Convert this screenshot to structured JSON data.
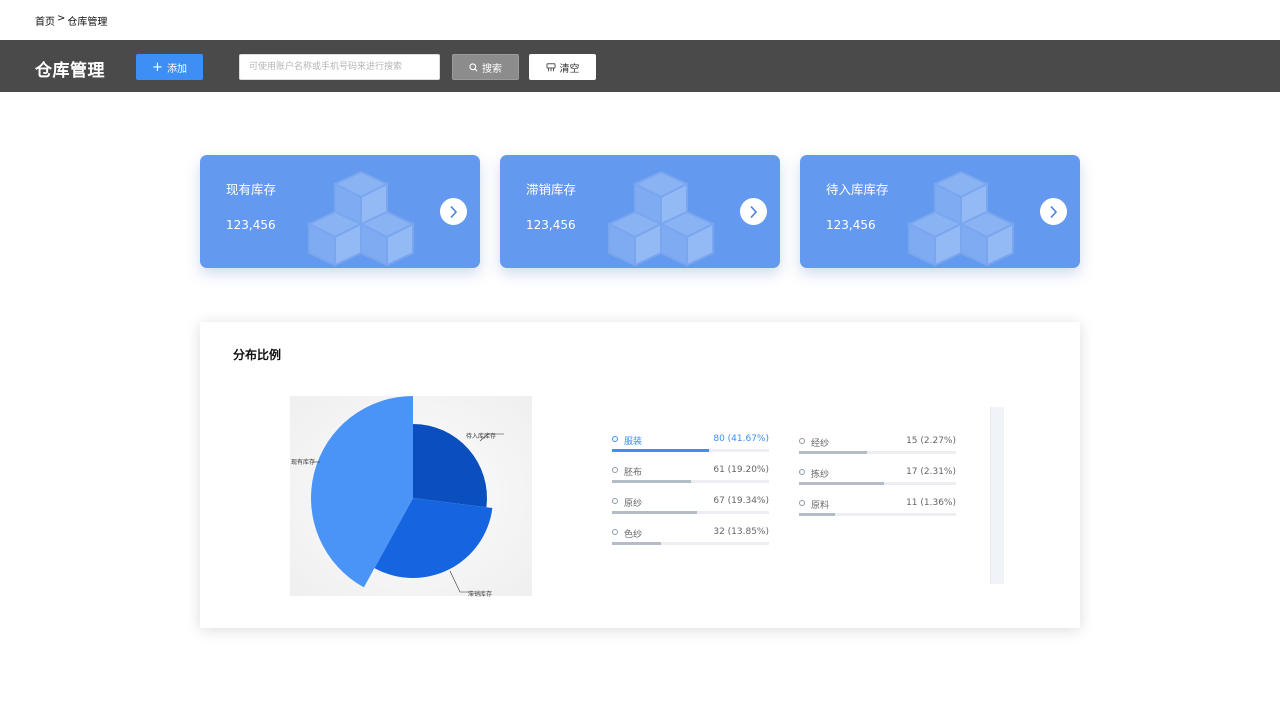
{
  "breadcrumb": {
    "home": "首页",
    "separator": ">",
    "current": "仓库管理"
  },
  "toolbar": {
    "title": "仓库管理",
    "add_label": "添加",
    "search_placeholder": "可使用账户名称或手机号码来进行搜索",
    "search_label": "搜索",
    "clear_label": "清空"
  },
  "cards": [
    {
      "label": "现有库存",
      "value": "123,456"
    },
    {
      "label": "滞销库存",
      "value": "123,456"
    },
    {
      "label": "待入库库存",
      "value": "123,456"
    }
  ],
  "distribution": {
    "title": "分布比例",
    "legend_left": [
      {
        "name": "服装",
        "value": "80 (41.67%)",
        "fraction": 0.62,
        "active": true
      },
      {
        "name": "胚布",
        "value": "61 (19.20%)",
        "fraction": 0.5
      },
      {
        "name": "原纱",
        "value": "67 (19.34%)",
        "fraction": 0.54
      },
      {
        "name": "色纱",
        "value": "32 (13.85%)",
        "fraction": 0.31
      }
    ],
    "legend_right": [
      {
        "name": "经纱",
        "value": "15 (2.27%)",
        "fraction": 0.43
      },
      {
        "name": "拣纱",
        "value": "17 (2.31%)",
        "fraction": 0.54
      },
      {
        "name": "原料",
        "value": "11 (1.36%)",
        "fraction": 0.23
      }
    ]
  },
  "chart_data": {
    "type": "pie",
    "labels": [
      "现有库存",
      "滞销库存",
      "待入库库存"
    ],
    "values": [
      42,
      31,
      27
    ],
    "colors": [
      "#4b94f7",
      "#1565e0",
      "#0b4fbe"
    ]
  },
  "colors": {
    "toolbar": "#4a4a4a",
    "primary": "#3d8ff6",
    "card": "#6399ee"
  }
}
